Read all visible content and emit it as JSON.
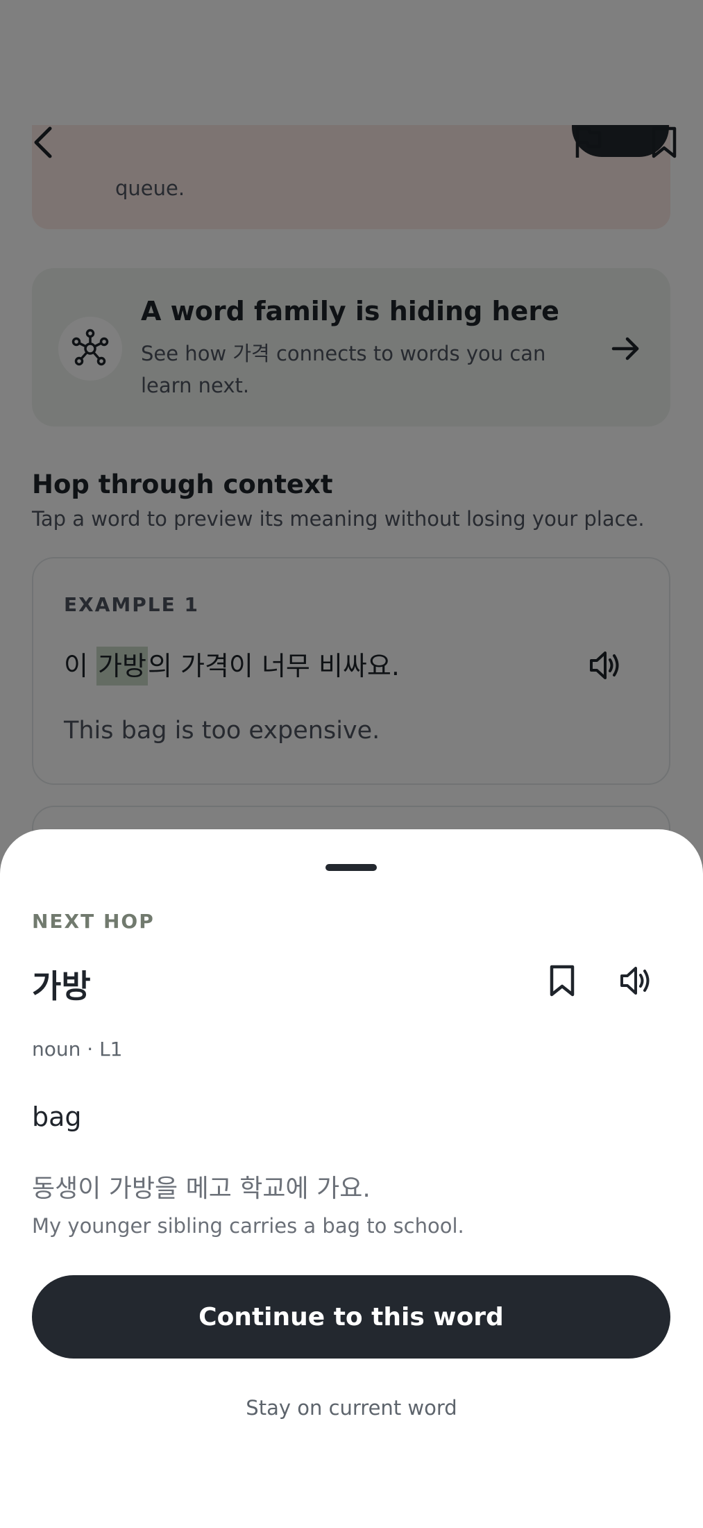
{
  "background_page": {
    "queue_banner_text": "queue.",
    "word_family": {
      "title": "A word family is hiding here",
      "description": "See how 가격 connects to words you can learn next."
    },
    "context_section": {
      "title": "Hop through context",
      "subtitle": "Tap a word to preview its meaning without losing your place."
    },
    "example_1": {
      "label": "EXAMPLE 1",
      "sentence_before": "이 ",
      "sentence_highlight": "가방",
      "sentence_after": "의 가격이 너무 비싸요.",
      "translation": "This bag is too expensive."
    },
    "icons": {
      "back": "chevron-left-icon",
      "flag": "flag-icon",
      "bookmark": "bookmark-icon",
      "network": "network-icon",
      "arrow": "arrow-right-icon",
      "speaker": "speaker-icon"
    },
    "colors": {
      "accent_dark": "#23282f",
      "family_card_bg": "#eef3ee",
      "highlight": "#c9d8c6",
      "banner_bg": "#fbe9e4"
    }
  },
  "sheet": {
    "eyebrow": "NEXT HOP",
    "word": "가방",
    "pos": "noun · L1",
    "meaning": "bag",
    "example_ko": "동생이 가방을 메고 학교에 가요.",
    "example_en": "My younger sibling carries a bag to school.",
    "primary_action": "Continue to this word",
    "secondary_action": "Stay on current word"
  }
}
